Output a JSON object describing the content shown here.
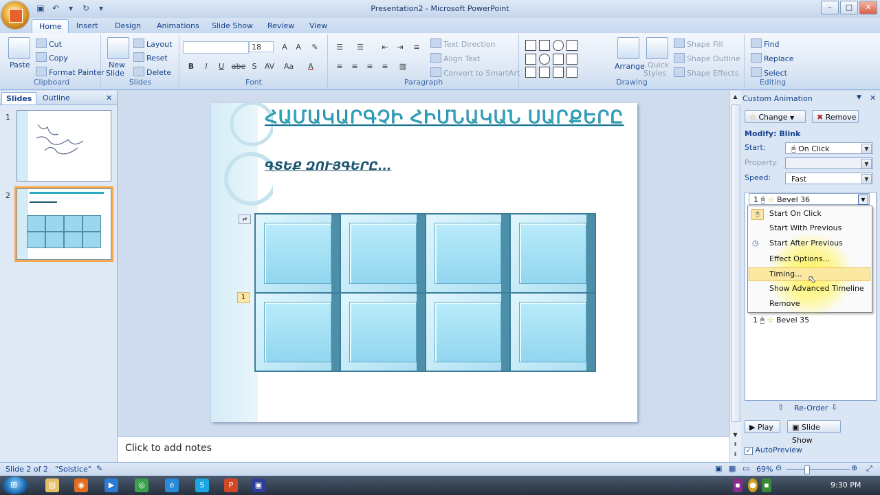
{
  "window": {
    "title": "Presentation2 - Microsoft PowerPoint"
  },
  "tabs": [
    "Home",
    "Insert",
    "Design",
    "Animations",
    "Slide Show",
    "Review",
    "View"
  ],
  "ribbon": {
    "clipboard": {
      "label": "Clipboard",
      "paste": "Paste",
      "cut": "Cut",
      "copy": "Copy",
      "format_painter": "Format Painter"
    },
    "slides": {
      "label": "Slides",
      "new_slide": "New",
      "new_slide2": "Slide",
      "layout": "Layout",
      "reset": "Reset",
      "delete": "Delete"
    },
    "font": {
      "label": "Font",
      "size": "18",
      "bold": "B",
      "italic": "I",
      "underline": "U",
      "strike": "abe",
      "shadow": "S",
      "spacing": "AV",
      "case": "Aa",
      "color": "A"
    },
    "paragraph": {
      "label": "Paragraph",
      "text_direction": "Text Direction",
      "align_text": "Align Text",
      "convert": "Convert to SmartArt"
    },
    "drawing": {
      "label": "Drawing",
      "arrange": "Arrange",
      "quick_styles": "Quick",
      "quick_styles2": "Styles",
      "shape_fill": "Shape Fill",
      "shape_outline": "Shape Outline",
      "shape_effects": "Shape Effects"
    },
    "editing": {
      "label": "Editing",
      "find": "Find",
      "replace": "Replace",
      "select": "Select"
    }
  },
  "slides_pane": {
    "tab_slides": "Slides",
    "tab_outline": "Outline",
    "thumbs": [
      {
        "num": "1"
      },
      {
        "num": "2"
      }
    ]
  },
  "slide": {
    "title": "ՀԱՄԱԿԱՐԳՉԻ ՀԻՄՆԱԿԱՆ ՍԱՐՔԵՐԸ",
    "subtitle": "ԳՏԵՔ ԶՈՒՅԳԵՐԸ...",
    "order_badge": "1"
  },
  "notes": {
    "placeholder": "Click to add notes"
  },
  "task_pane": {
    "title": "Custom Animation",
    "change_btn": "Change",
    "remove_btn": "Remove",
    "modify_label": "Modify: Blink",
    "start_label": "Start:",
    "start_value": "On Click",
    "property_label": "Property:",
    "speed_label": "Speed:",
    "speed_value": "Fast",
    "list_items": [
      {
        "num": "1",
        "name": "Bevel 36"
      },
      {
        "num": "1",
        "name": "Bevel 35"
      }
    ],
    "reorder": "Re-Order",
    "play": "Play",
    "slide_show": "Slide Show",
    "autopreview": "AutoPreview"
  },
  "context_menu": [
    "Start On Click",
    "Start With Previous",
    "Start After Previous",
    "Effect Options...",
    "Timing...",
    "Show Advanced Timeline",
    "Remove"
  ],
  "status": {
    "slide_info": "Slide 2 of 2",
    "theme": "\"Solstice\"",
    "zoom": "69%"
  },
  "taskbar": {
    "time": "9:30 PM"
  },
  "colors": {
    "accent": "#15428b",
    "title_teal": "#2aa8c2",
    "highlight": "#fbe8a1",
    "selection_orange": "#f5a94a"
  }
}
